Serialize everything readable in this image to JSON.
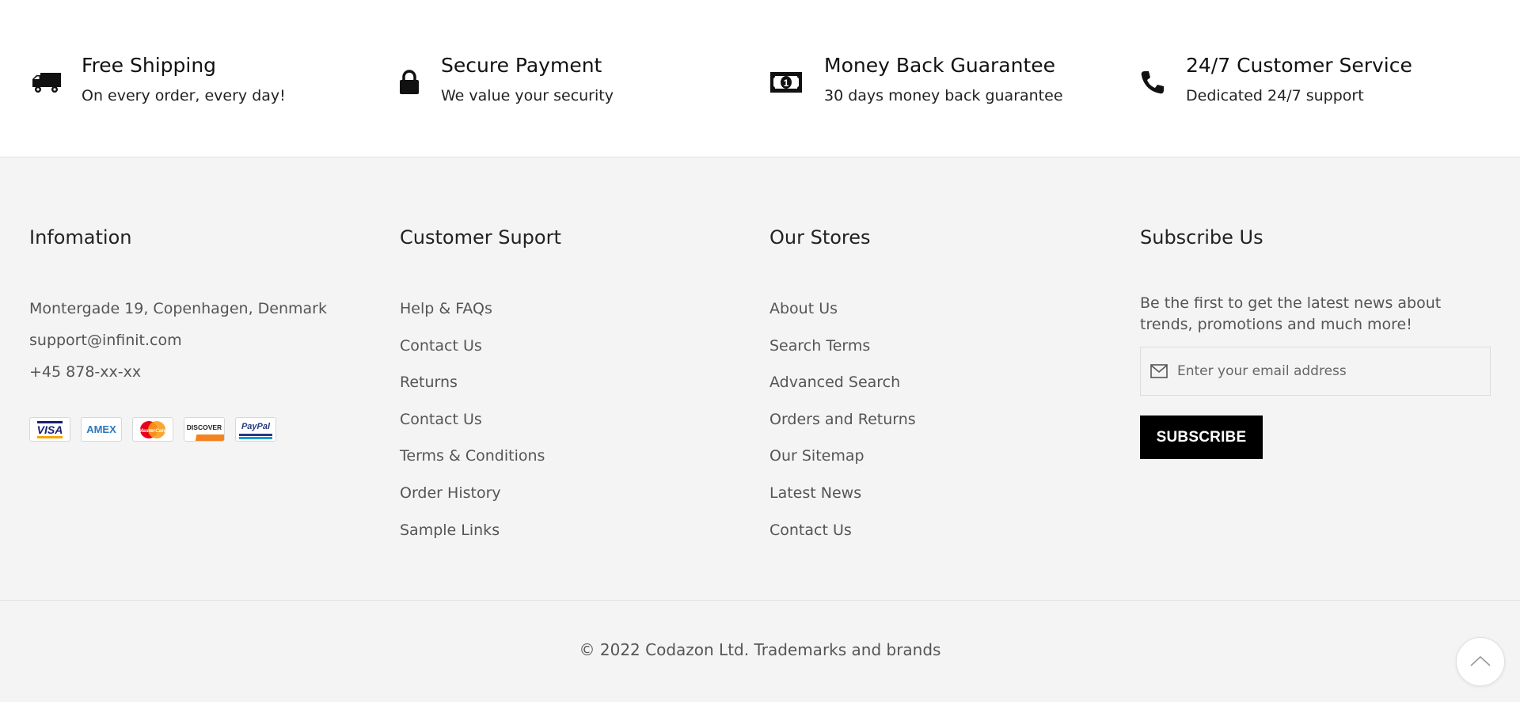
{
  "features": [
    {
      "icon": "truck-icon",
      "title": "Free Shipping",
      "subtitle": "On every order, every day!"
    },
    {
      "icon": "lock-icon",
      "title": "Secure Payment",
      "subtitle": "We value your security"
    },
    {
      "icon": "money-icon",
      "title": "Money Back Guarantee",
      "subtitle": "30 days money back guarantee"
    },
    {
      "icon": "phone-icon",
      "title": "24/7 Customer Service",
      "subtitle": "Dedicated 24/7 support"
    }
  ],
  "information": {
    "title": "Infomation",
    "address": "Montergade 19, Copenhagen, Denmark",
    "email": "support@infinit.com",
    "phone": "+45 878-xx-xx",
    "payments": [
      "VISA",
      "AMEX",
      "MasterCard",
      "DISCOVER",
      "PayPal"
    ]
  },
  "customer_support": {
    "title": "Customer Suport",
    "links": [
      "Help & FAQs",
      "Contact Us",
      "Returns",
      "Contact Us",
      "Terms & Conditions",
      "Order History",
      "Sample Links"
    ]
  },
  "our_stores": {
    "title": "Our Stores",
    "links": [
      "About Us",
      "Search Terms",
      "Advanced Search",
      "Orders and Returns",
      "Our Sitemap",
      "Latest News",
      "Contact Us"
    ]
  },
  "subscribe": {
    "title": "Subscribe Us",
    "text": "Be the first to get the latest news about trends, promotions and much more!",
    "placeholder": "Enter your email address",
    "button": "SUBSCRIBE"
  },
  "copyright": "© 2022 Codazon Ltd. Trademarks and brands"
}
